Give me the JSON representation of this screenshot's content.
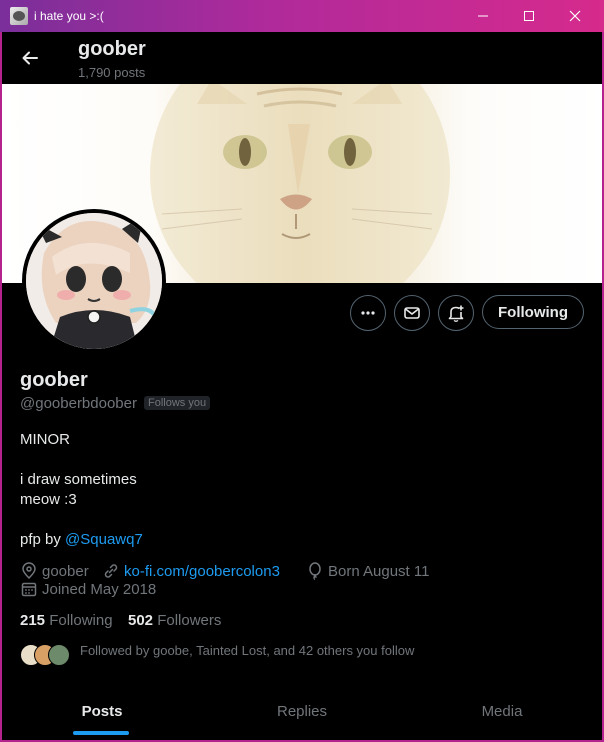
{
  "window": {
    "title": "i hate you >:("
  },
  "header": {
    "name": "goober",
    "post_count": "1,790 posts"
  },
  "actions": {
    "following_label": "Following"
  },
  "profile": {
    "name": "goober",
    "handle": "@gooberbdoober",
    "follows_you": "Follows you",
    "bio_line1": "MINOR",
    "bio_line2": "i draw sometimes",
    "bio_line3": "meow :3",
    "pfp_prefix": "pfp by",
    "pfp_link": "@Squawq7",
    "location": "goober",
    "website": "ko-fi.com/goobercolon3",
    "birthday": "Born August 11",
    "joined": "Joined May 2018"
  },
  "stats": {
    "following_count": "215",
    "following_label": "Following",
    "followers_count": "502",
    "followers_label": "Followers"
  },
  "followed_by": "Followed by goobe, Tainted Lost, and 42 others you follow",
  "tabs": {
    "posts": "Posts",
    "replies": "Replies",
    "media": "Media"
  },
  "colors": {
    "accent": "#1d9bf0",
    "window_border": "#b4238d",
    "muted": "#71767b"
  }
}
